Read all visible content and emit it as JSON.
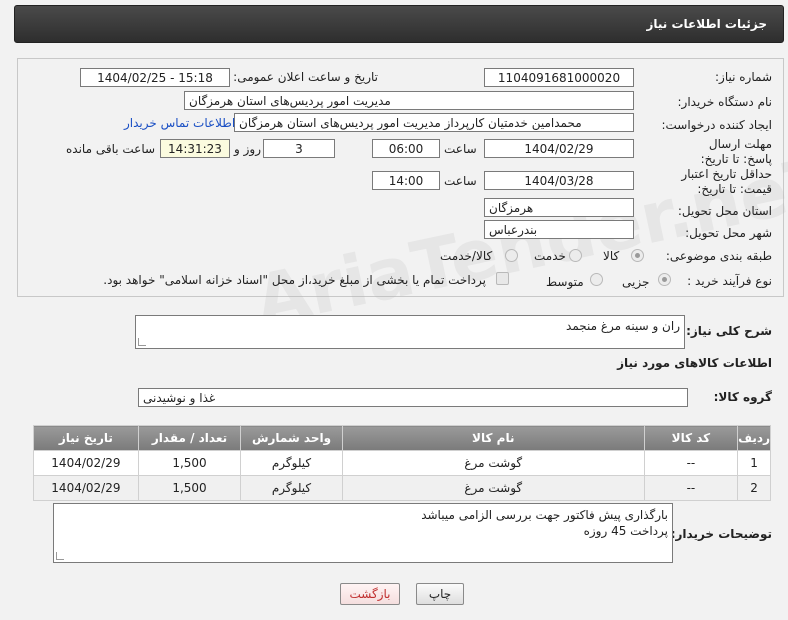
{
  "header": {
    "title": "جزئیات اطلاعات نیاز"
  },
  "fields": {
    "need_number": {
      "label": "شماره نیاز:",
      "value": "1104091681000020"
    },
    "announce_datetime": {
      "label": "تاریخ و ساعت اعلان عمومی:",
      "value": "1404/02/25 - 15:18"
    },
    "buyer_org": {
      "label": "نام دستگاه خریدار:",
      "value": "مدیریت امور پردیس‌های استان هرمزگان"
    },
    "requester": {
      "label": "ایجاد کننده درخواست:",
      "value": "محمدامین خدمتیان کارپرداز مدیریت امور پردیس‌های استان هرمزگان"
    },
    "contact_link": "اطلاعات تماس خریدار",
    "response_deadline": {
      "label": "مهلت ارسال پاسخ: تا تاریخ:",
      "date": "1404/02/29",
      "time_label": "ساعت",
      "time": "06:00",
      "days": "3",
      "days_label": "روز و",
      "remaining": "14:31:23",
      "remaining_label": "ساعت باقی مانده"
    },
    "price_validity": {
      "label": "حداقل تاریخ اعتبار قیمت: تا تاریخ:",
      "date": "1404/03/28",
      "time_label": "ساعت",
      "time": "14:00"
    },
    "province": {
      "label": "استان محل تحویل:",
      "value": "هرمزگان"
    },
    "city": {
      "label": "شهر محل تحویل:",
      "value": "بندرعباس"
    },
    "category": {
      "label": "طبقه بندی موضوعی:",
      "options": [
        "کالا",
        "خدمت",
        "کالا/خدمت"
      ],
      "selected": "کالا"
    },
    "purchase_type": {
      "label": "نوع فرآیند خرید :",
      "options": [
        "جزیی",
        "متوسط"
      ],
      "selected": "جزیی",
      "note": "پرداخت تمام یا بخشی از مبلغ خرید،از محل \"اسناد خزانه اسلامی\" خواهد بود."
    }
  },
  "description": {
    "label": "شرح کلی نیاز:",
    "value": "ران و سینه مرغ منجمد"
  },
  "goods_section": {
    "title": "اطلاعات کالاهای مورد نیاز"
  },
  "goods_group": {
    "label": "گروه کالا:",
    "value": "غذا و نوشیدنی"
  },
  "table": {
    "headers": [
      "ردیف",
      "کد کالا",
      "نام کالا",
      "واحد شمارش",
      "تعداد / مقدار",
      "تاریخ نیاز"
    ],
    "rows": [
      [
        "1",
        "--",
        "گوشت مرغ",
        "کیلوگرم",
        "1,500",
        "1404/02/29"
      ],
      [
        "2",
        "--",
        "گوشت مرغ",
        "کیلوگرم",
        "1,500",
        "1404/02/29"
      ]
    ]
  },
  "buyer_notes": {
    "label": "توضیحات خریدار:",
    "line1": "بارگذاری پیش فاکتور جهت بررسی الزامی میباشد",
    "line2": "پرداخت 45 روزه"
  },
  "buttons": {
    "print": "چاپ",
    "back": "بازگشت"
  },
  "watermark": "AriaTender.neT",
  "colors": {
    "header_bg": "#3a3a3a",
    "link": "#1a4fc4",
    "back_button_text": "#c03030"
  }
}
